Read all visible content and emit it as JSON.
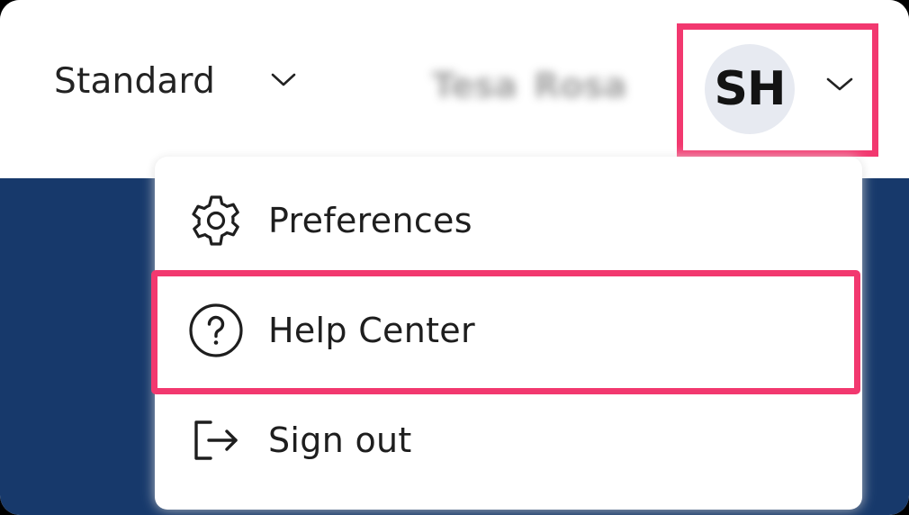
{
  "header": {
    "mode_select": {
      "value": "Standard",
      "icon": "chevron-down-icon"
    },
    "user": {
      "name_parts": [
        "Tesa",
        "Rosa"
      ],
      "initials": "SH",
      "icon": "chevron-down-icon"
    }
  },
  "account_menu": {
    "items": [
      {
        "label": "Preferences",
        "icon": "gear-icon"
      },
      {
        "label": "Help Center",
        "icon": "help-circle-icon"
      },
      {
        "label": "Sign out",
        "icon": "sign-out-icon"
      }
    ]
  },
  "colors": {
    "highlight": "#f2386f",
    "banner": "#17396b",
    "avatar_bg": "#e7eaf1"
  }
}
